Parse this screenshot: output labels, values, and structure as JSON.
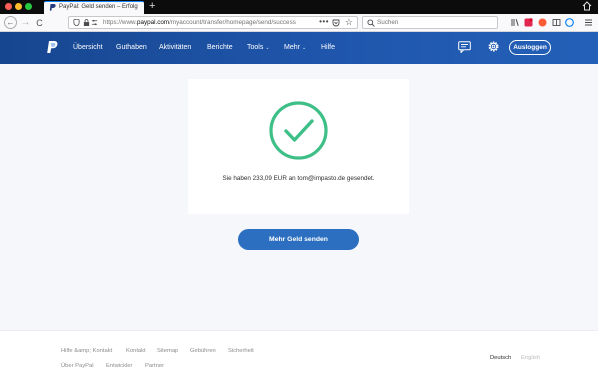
{
  "browser": {
    "tab_title": "PayPal: Geld senden – Erfolg",
    "new_tab": "+",
    "url_prefix": "https://www.",
    "url_domain": "paypal.com",
    "url_path": "/myaccount/transfer/homepage/send/success",
    "url_more": "•••",
    "search_placeholder": "Suchen",
    "back": "←",
    "forward": "→",
    "reload": "C",
    "star": "☆"
  },
  "header": {
    "nav": [
      {
        "label": "Übersicht"
      },
      {
        "label": "Guthaben"
      },
      {
        "label": "Aktivitäten"
      },
      {
        "label": "Berichte"
      },
      {
        "label": "Tools",
        "caret": "⌄"
      },
      {
        "label": "Mehr",
        "caret": "⌄"
      },
      {
        "label": "Hilfe"
      }
    ],
    "logout_label": "Ausloggen"
  },
  "main": {
    "success_message": "Sie haben 233,09 EUR an tom@impasto.de gesendet.",
    "send_more_label": "Mehr Geld senden"
  },
  "footer": {
    "row1": [
      "Hilfe &amp; Kontakt",
      "Kontakt",
      "Sitemap",
      "Gebühren",
      "Sicherheit"
    ],
    "row2": [
      "Über PayPal",
      "Entwickler",
      "Partner"
    ],
    "languages": [
      "Deutsch",
      "English"
    ]
  },
  "colors": {
    "header_bg": "#1f56ac",
    "button_bg": "#2c6fc1",
    "success_green": "#3dbf87"
  }
}
